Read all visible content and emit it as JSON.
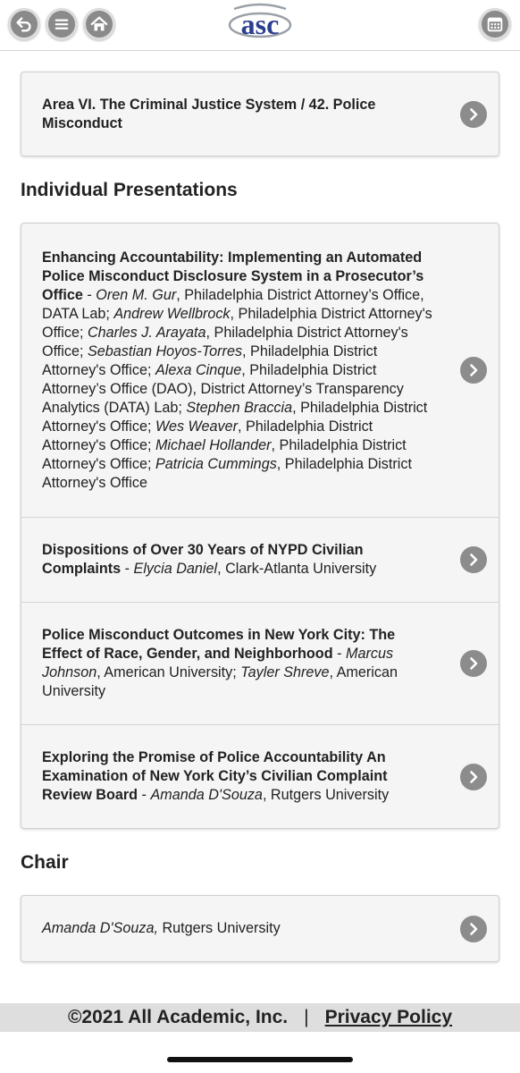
{
  "header": {
    "logo_text": "asc",
    "back_icon": "back-arrow-icon",
    "menu_icon": "menu-icon",
    "home_icon": "home-icon",
    "calendar_icon": "calendar-icon"
  },
  "area_card": {
    "label": "Area VI. The Criminal Justice System / 42. Police Misconduct"
  },
  "individual_presentations": {
    "title": "Individual Presentations",
    "items": [
      {
        "title": "Enhancing Accountability: Implementing an Automated Police Misconduct Disclosure System in a Prosecutor’s Office",
        "sep": " - ",
        "authors": [
          {
            "name": "Oren M. Gur",
            "affil": ", Philadelphia District Attorney’s Office, DATA Lab; "
          },
          {
            "name": "Andrew Wellbrock",
            "affil": ", Philadelphia District Attorney's Office; "
          },
          {
            "name": "Charles J. Arayata",
            "affil": ", Philadelphia District Attorney's Office; "
          },
          {
            "name": "Sebastian Hoyos-Torres",
            "affil": ", Philadelphia District Attorney's Office; "
          },
          {
            "name": "Alexa Cinque",
            "affil": ", Philadelphia District Attorney’s Office (DAO), District Attorney’s Transparency Analytics (DATA) Lab; "
          },
          {
            "name": "Stephen Braccia",
            "affil": ", Philadelphia District Attorney's Office; "
          },
          {
            "name": "Wes Weaver",
            "affil": ", Philadelphia District Attorney's Office; "
          },
          {
            "name": "Michael Hollander",
            "affil": ", Philadelphia District Attorney's Office; "
          },
          {
            "name": "Patricia Cummings",
            "affil": ", Philadelphia District Attorney's Office"
          }
        ]
      },
      {
        "title": "Dispositions of Over 30 Years of NYPD Civilian Complaints",
        "sep": " - ",
        "authors": [
          {
            "name": "Elycia Daniel",
            "affil": ", Clark-Atlanta University"
          }
        ]
      },
      {
        "title": "Police Misconduct Outcomes in New York City: The Effect of Race, Gender, and Neighborhood",
        "sep": " - ",
        "authors": [
          {
            "name": "Marcus Johnson",
            "affil": ", American University; "
          },
          {
            "name": "Tayler Shreve",
            "affil": ", American University"
          }
        ]
      },
      {
        "title": "Exploring the Promise of Police Accountability An Examination of New York City’s Civilian Complaint Review Board",
        "sep": " - ",
        "authors": [
          {
            "name": "Amanda D'Souza",
            "affil": ", Rutgers University"
          }
        ]
      }
    ]
  },
  "chair": {
    "title": "Chair",
    "name": "Amanda D'Souza,",
    "affil": " Rutgers University"
  },
  "footer": {
    "copyright": "©2021 All Academic, Inc.",
    "separator": "|",
    "privacy": "Privacy Policy"
  },
  "colors": {
    "button_gray": "#8a8a8a",
    "logo_blue": "#2b3f8f",
    "logo_gray": "#9aa0a8",
    "footer_bg": "#dedede"
  }
}
